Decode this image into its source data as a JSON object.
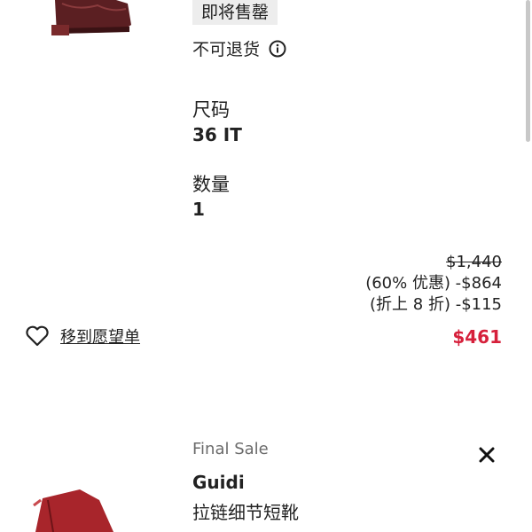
{
  "item1": {
    "badge": "即将售罄",
    "non_returnable": "不可退货",
    "size_label": "尺码",
    "size_value": "36 IT",
    "qty_label": "数量",
    "qty_value": "1",
    "price_original": "$1,440",
    "discount1": "(60% 优惠) -$864",
    "discount2": "(折上 8 折) -$115",
    "price_final": "$461",
    "wishlist_label": "移到愿望单"
  },
  "item2": {
    "tag": "Final Sale",
    "brand": "Guidi",
    "name": "拉链细节短靴"
  },
  "colors": {
    "sale_red": "#d6203b",
    "badge_bg": "#ededed"
  },
  "icons": [
    "info-icon",
    "heart-icon",
    "close-icon"
  ]
}
